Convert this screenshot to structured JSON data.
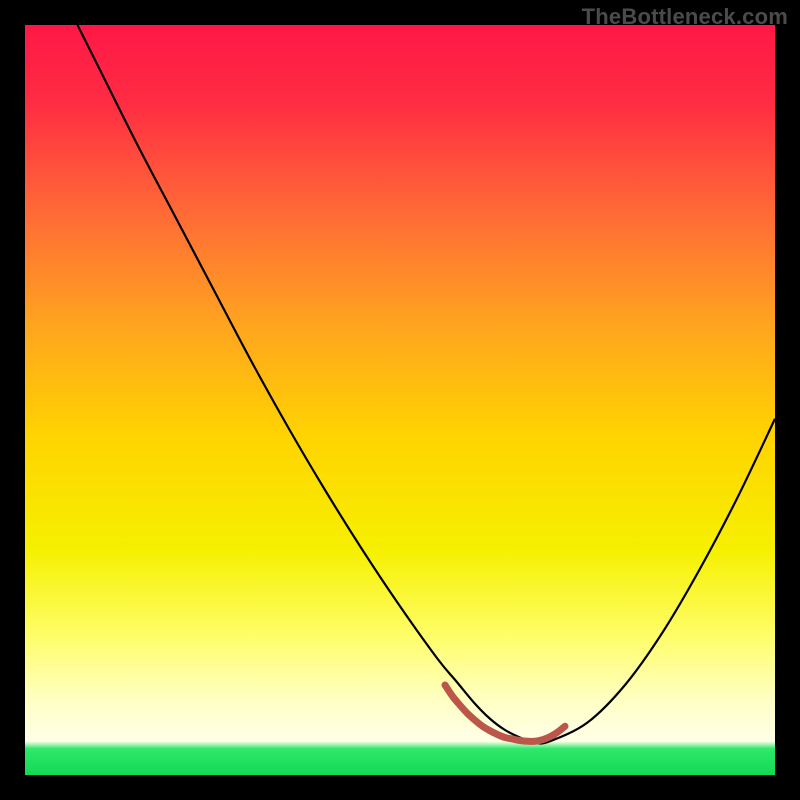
{
  "watermark": "TheBottleneck.com",
  "chart_data": {
    "type": "line",
    "title": "",
    "xlabel": "",
    "ylabel": "",
    "xlim": [
      0,
      100
    ],
    "ylim": [
      0,
      100
    ],
    "grid": false,
    "legend": false,
    "annotations": [],
    "gradient_stops": [
      {
        "offset": 0.0,
        "color": "#ff1846"
      },
      {
        "offset": 0.1,
        "color": "#ff2b43"
      },
      {
        "offset": 0.25,
        "color": "#ff6a36"
      },
      {
        "offset": 0.4,
        "color": "#ffa41f"
      },
      {
        "offset": 0.55,
        "color": "#ffd400"
      },
      {
        "offset": 0.7,
        "color": "#f6f000"
      },
      {
        "offset": 0.82,
        "color": "#fffe6e"
      },
      {
        "offset": 0.9,
        "color": "#ffffc4"
      },
      {
        "offset": 0.955,
        "color": "#ffffe8"
      },
      {
        "offset": 0.965,
        "color": "#2ee86b"
      },
      {
        "offset": 1.0,
        "color": "#14d952"
      }
    ],
    "series": [
      {
        "name": "bottleneck-curve",
        "color": "#000000",
        "x": [
          7,
          10,
          15,
          20,
          25,
          30,
          35,
          40,
          45,
          50,
          55,
          57.5,
          60,
          62,
          64,
          66,
          68,
          70,
          75,
          80,
          85,
          90,
          95,
          100
        ],
        "y": [
          100,
          94,
          84,
          74.5,
          65,
          55.5,
          46.5,
          38,
          30,
          22.5,
          15.5,
          12.5,
          9.5,
          7.5,
          6,
          5,
          4.3,
          4.5,
          7,
          12,
          19,
          27.5,
          37,
          47.5
        ]
      },
      {
        "name": "optimal-zone-marker",
        "color": "#bc564b",
        "x": [
          56,
          57,
          58,
          59,
          60,
          61,
          62,
          63,
          64,
          65,
          66,
          67,
          68,
          69,
          70,
          71,
          72
        ],
        "y": [
          12,
          10.5,
          9.3,
          8.2,
          7.3,
          6.5,
          5.9,
          5.4,
          5,
          4.8,
          4.6,
          4.5,
          4.5,
          4.7,
          5.1,
          5.7,
          6.5
        ]
      }
    ]
  }
}
